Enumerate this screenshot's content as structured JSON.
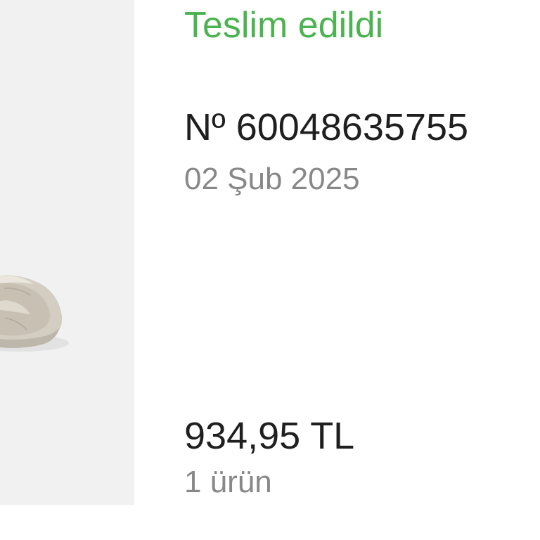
{
  "order": {
    "status": "Teslim edildi",
    "number": "Nº 60048635755",
    "date": "02 Şub 2025",
    "price": "934,95 TL",
    "item_count": "1 ürün"
  },
  "colors": {
    "status_green": "#4bb34f",
    "primary_text": "#1f1f1f",
    "secondary_text": "#888888",
    "thumb_background": "#f1f1f1"
  }
}
